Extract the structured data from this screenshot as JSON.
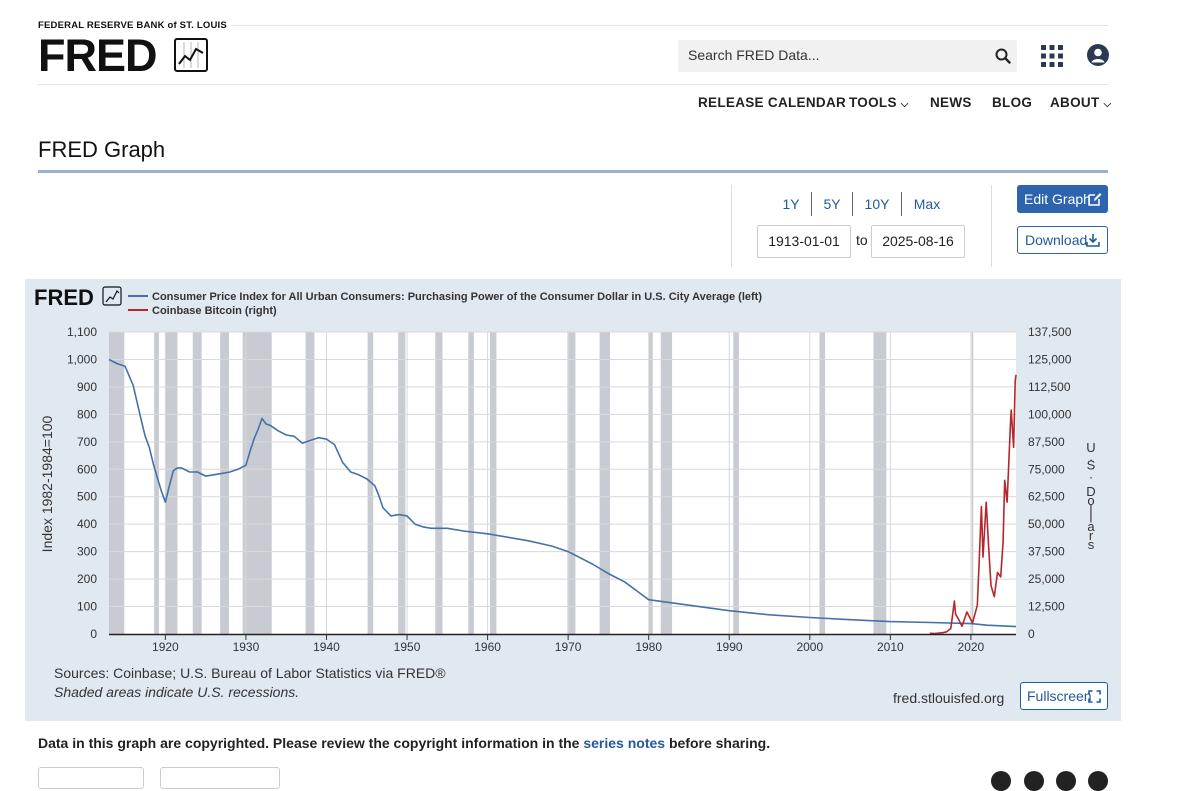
{
  "header": {
    "org": "FEDERAL RESERVE BANK of ST. LOUIS",
    "logo": "FRED",
    "search_placeholder": "Search FRED Data...",
    "icons": [
      "search-icon",
      "apps-grid-icon",
      "user-icon"
    ]
  },
  "nav": [
    {
      "label": "RELEASE CALENDAR",
      "caret": false
    },
    {
      "label": "TOOLS",
      "caret": true
    },
    {
      "label": "NEWS",
      "caret": false
    },
    {
      "label": "BLOG",
      "caret": false
    },
    {
      "label": "ABOUT",
      "caret": true
    }
  ],
  "page_title": "FRED Graph",
  "controls": {
    "ranges": [
      "1Y",
      "5Y",
      "10Y",
      "Max"
    ],
    "start_date": "1913-01-01",
    "to_label": "to",
    "end_date": "2025-08-16",
    "edit_label": "Edit Graph",
    "download_label": "Download"
  },
  "graph": {
    "sources": "Sources: Coinbase; U.S. Bureau of Labor Statistics via FRED®",
    "shaded_prefix": "Shaded areas indicate U.S. recessions.",
    "url": "fred.stlouisfed.org",
    "fullscreen_label": "Fullscreen"
  },
  "notice": {
    "prefix": "Data in this graph are copyrighted. Please review the copyright information in the",
    "link": "series notes",
    "suffix": "before sharing."
  },
  "colors": {
    "brand": "#2e64ad",
    "cpi_line": "#4472a8",
    "btc_line": "#b5272c",
    "recession": "#c8ccd2",
    "panel": "#e1e9f0"
  },
  "chart_data": {
    "type": "line",
    "legend_mark": "FRED",
    "x_ticks": [
      "1920",
      "1930",
      "1940",
      "1950",
      "1960",
      "1970",
      "1980",
      "1990",
      "2000",
      "2010",
      "2020"
    ],
    "y_left_label": "Index 1982-1984=100",
    "y_left_ticks": [
      "0",
      "100",
      "200",
      "300",
      "400",
      "500",
      "600",
      "700",
      "800",
      "900",
      "1,000",
      "1,100"
    ],
    "y_left_lim": [
      0,
      1100
    ],
    "y_right_label": "U.S. Dollars",
    "y_right_ticks": [
      "0",
      "12,500",
      "25,000",
      "37,500",
      "50,000",
      "62,500",
      "75,000",
      "87,500",
      "100,000",
      "112,500",
      "125,000",
      "137,500"
    ],
    "y_right_lim": [
      0,
      137500
    ],
    "x_range": [
      1913,
      2025.6
    ],
    "recessions": [
      [
        1913.0,
        1914.9
      ],
      [
        1918.6,
        1919.2
      ],
      [
        1920.0,
        1921.5
      ],
      [
        1923.4,
        1924.5
      ],
      [
        1926.8,
        1927.9
      ],
      [
        1929.6,
        1933.2
      ],
      [
        1937.4,
        1938.5
      ],
      [
        1945.1,
        1945.8
      ],
      [
        1948.9,
        1949.8
      ],
      [
        1953.5,
        1954.4
      ],
      [
        1957.6,
        1958.3
      ],
      [
        1960.3,
        1961.1
      ],
      [
        1969.9,
        1970.9
      ],
      [
        1973.9,
        1975.2
      ],
      [
        1980.0,
        1980.5
      ],
      [
        1981.5,
        1982.9
      ],
      [
        1990.5,
        1991.2
      ],
      [
        2001.2,
        2001.9
      ],
      [
        2007.9,
        2009.5
      ],
      [
        2020.1,
        2020.3
      ]
    ],
    "series": [
      {
        "name": "Consumer Price Index for All Urban Consumers: Purchasing Power of the Consumer Dollar in U.S. City Average (left)",
        "axis": "left",
        "color": "#4472a8",
        "x": [
          1913,
          1914,
          1915,
          1916,
          1917,
          1917.5,
          1918,
          1918.5,
          1919,
          1919.5,
          1920,
          1920.5,
          1921,
          1921.5,
          1922,
          1923,
          1924,
          1925,
          1926,
          1927,
          1928,
          1929,
          1930,
          1930.5,
          1931,
          1931.5,
          1932,
          1932.5,
          1933,
          1934,
          1935,
          1936,
          1937,
          1938,
          1939,
          1940,
          1941,
          1942,
          1943,
          1944,
          1945,
          1946,
          1946.5,
          1947,
          1948,
          1949,
          1950,
          1951,
          1952,
          1953,
          1955,
          1957,
          1960,
          1965,
          1968,
          1970,
          1973,
          1975,
          1977,
          1980,
          1985,
          1990,
          1995,
          2000,
          2005,
          2010,
          2015,
          2020,
          2022,
          2025.6
        ],
        "values": [
          1000,
          985,
          975,
          905,
          780,
          720,
          680,
          620,
          570,
          520,
          480,
          540,
          595,
          605,
          605,
          590,
          590,
          575,
          580,
          585,
          590,
          600,
          615,
          665,
          710,
          745,
          785,
          765,
          760,
          740,
          725,
          720,
          695,
          705,
          715,
          710,
          690,
          625,
          590,
          580,
          565,
          540,
          505,
          460,
          430,
          435,
          430,
          400,
          390,
          385,
          385,
          375,
          365,
          340,
          320,
          300,
          255,
          220,
          190,
          125,
          105,
          85,
          70,
          60,
          52,
          45,
          42,
          38,
          32,
          27
        ]
      },
      {
        "name": "Coinbase Bitcoin (right)",
        "axis": "right",
        "color": "#b5272c",
        "x": [
          2014.9,
          2015.5,
          2016.5,
          2017.0,
          2017.5,
          2017.95,
          2018.1,
          2018.5,
          2018.9,
          2019.5,
          2019.9,
          2020.2,
          2020.5,
          2020.8,
          2021.0,
          2021.3,
          2021.5,
          2021.9,
          2022.2,
          2022.5,
          2022.9,
          2023.3,
          2023.7,
          2024.0,
          2024.2,
          2024.5,
          2024.9,
          2025.0,
          2025.3,
          2025.5,
          2025.6
        ],
        "values": [
          300,
          250,
          600,
          1000,
          2500,
          15000,
          9000,
          6500,
          3500,
          10000,
          7200,
          5000,
          9000,
          13000,
          30000,
          58000,
          35000,
          60000,
          40000,
          22000,
          17000,
          28000,
          26000,
          42000,
          70000,
          60000,
          95000,
          102000,
          85000,
          115000,
          118000
        ]
      }
    ]
  }
}
